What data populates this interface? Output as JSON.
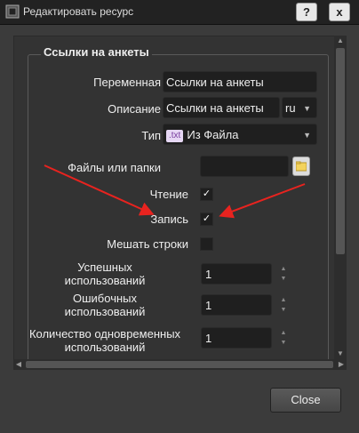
{
  "window": {
    "title": "Редактировать ресурс",
    "help_label": "?",
    "close_label": "x"
  },
  "group": {
    "title": "Ссылки на анкеты"
  },
  "form": {
    "variable": {
      "label": "Переменная",
      "value": "Ссылки на анкеты"
    },
    "description": {
      "label": "Описание",
      "value": "Ссылки на анкеты",
      "lang": "ru"
    },
    "type": {
      "label": "Тип",
      "badge": ".txt",
      "value": "Из Файла"
    },
    "files": {
      "label": "Файлы или папки",
      "value": ""
    },
    "read": {
      "label": "Чтение",
      "checked": "✓"
    },
    "write": {
      "label": "Запись",
      "checked": "✓"
    },
    "shuffle": {
      "label": "Мешать строки",
      "checked": ""
    },
    "success": {
      "label_line1": "Успешных",
      "label_line2": "использований",
      "value": "1"
    },
    "errors": {
      "label_line1": "Ошибочных",
      "label_line2": "использований",
      "value": "1"
    },
    "concurrent": {
      "label_line1": "Количество одновременных",
      "label_line2": "использований",
      "value": "1"
    }
  },
  "footer": {
    "close_label": "Close"
  },
  "colors": {
    "arrow": "#e8231f",
    "background": "#3b3b3b",
    "field": "#1f1f1f"
  }
}
